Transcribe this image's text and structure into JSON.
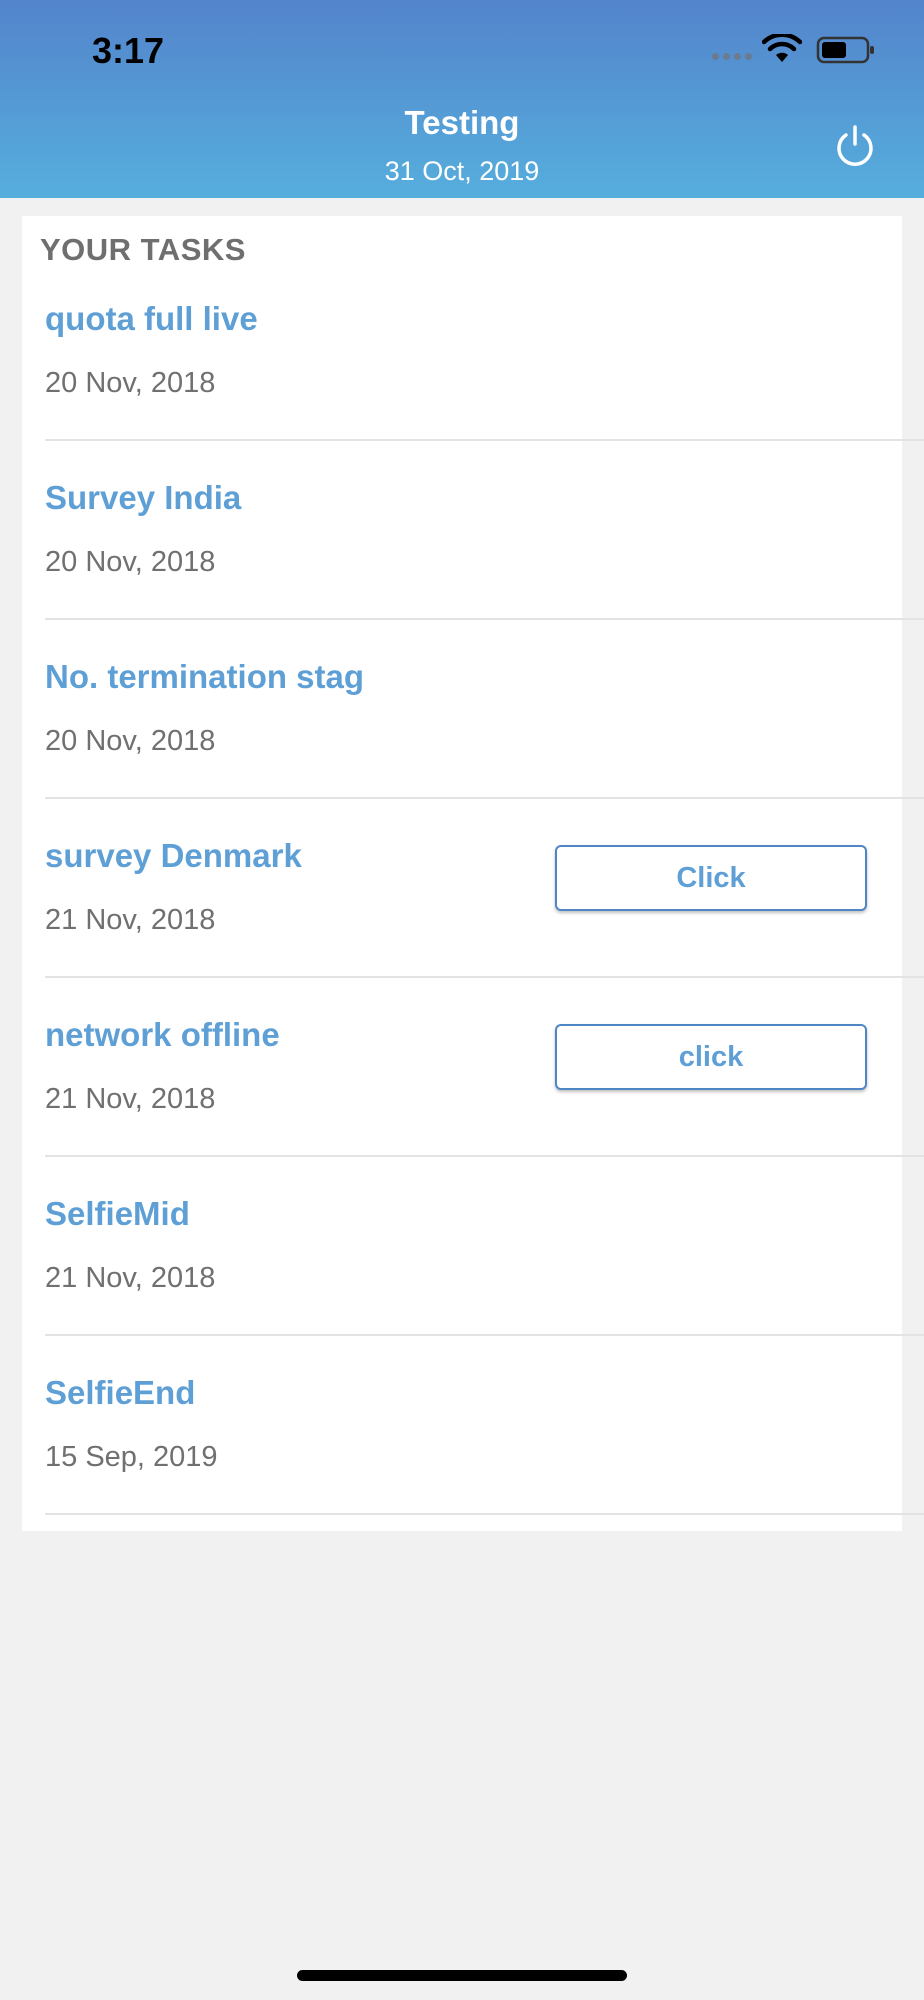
{
  "status_bar": {
    "time": "3:17"
  },
  "header": {
    "title": "Testing",
    "date": "31 Oct, 2019",
    "power_icon": "power-icon"
  },
  "tasks_card": {
    "heading": "YOUR TASKS",
    "items": [
      {
        "title": "quota full live",
        "date": "20 Nov, 2018",
        "button": null
      },
      {
        "title": "Survey India",
        "date": "20 Nov, 2018",
        "button": null
      },
      {
        "title": "No. termination stag",
        "date": "20 Nov, 2018",
        "button": null
      },
      {
        "title": "survey Denmark",
        "date": "21 Nov, 2018",
        "button": "Click"
      },
      {
        "title": "network offline",
        "date": "21 Nov, 2018",
        "button": "click"
      },
      {
        "title": "SelfieMid",
        "date": "21 Nov, 2018",
        "button": null
      },
      {
        "title": "SelfieEnd",
        "date": "15 Sep, 2019",
        "button": null
      }
    ]
  },
  "colors": {
    "header_top": "#5384cc",
    "header_bottom": "#56aedd",
    "task_title": "#5e9fd6",
    "button_border": "#4f86c6",
    "background": "#f1f1f1"
  }
}
